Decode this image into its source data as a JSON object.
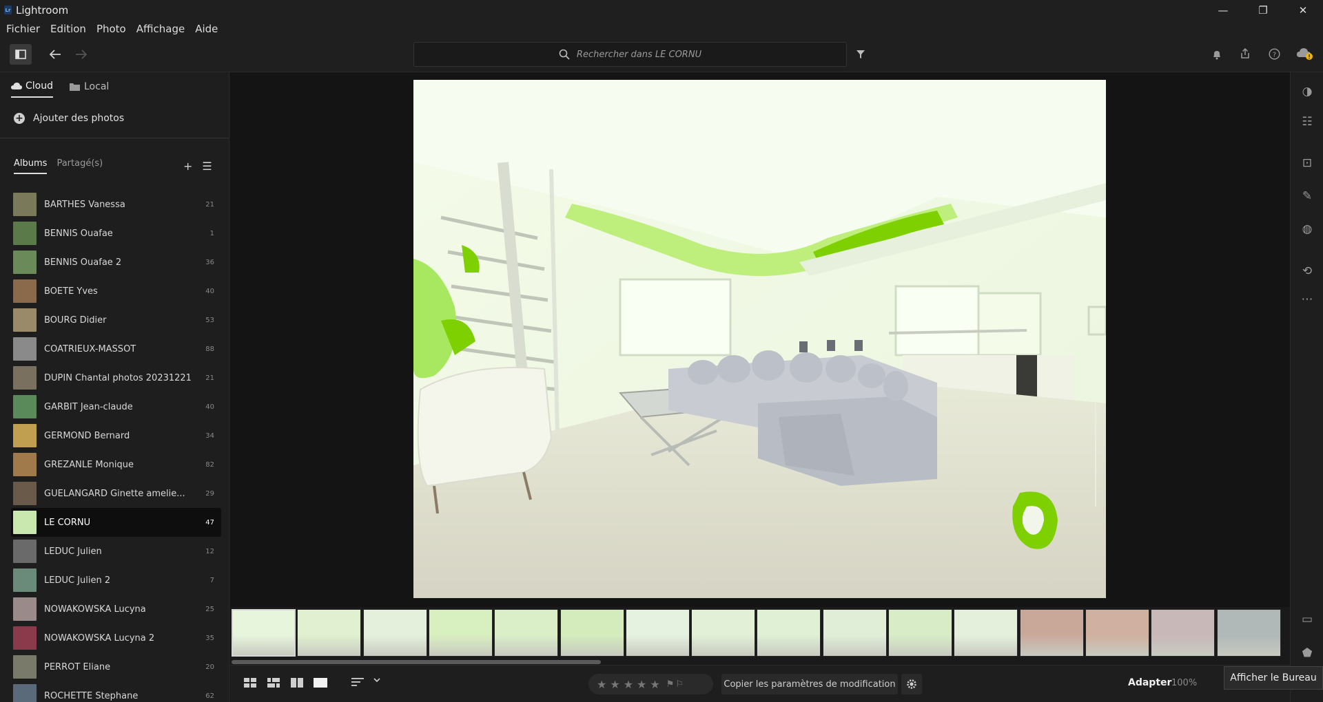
{
  "window": {
    "title": "Lightroom",
    "controls": [
      "minimize-icon",
      "restore-icon",
      "close-icon"
    ]
  },
  "menu": [
    "Fichier",
    "Edition",
    "Photo",
    "Affichage",
    "Aide"
  ],
  "search": {
    "placeholder": "Rechercher dans LE CORNU"
  },
  "source_tabs": {
    "cloud": "Cloud",
    "local": "Local"
  },
  "add_photos": "Ajouter des photos",
  "album_tabs": {
    "albums": "Albums",
    "shared": "Partagé(s)"
  },
  "albums": [
    {
      "name": "BARTHES Vanessa",
      "count": "21",
      "color": "#7a7a5a"
    },
    {
      "name": "BENNIS Ouafae",
      "count": "1",
      "color": "#5a7a4a"
    },
    {
      "name": "BENNIS Ouafae 2",
      "count": "36",
      "color": "#6a8a5a"
    },
    {
      "name": "BOETE Yves",
      "count": "40",
      "color": "#8a6a4a"
    },
    {
      "name": "BOURG Didier",
      "count": "53",
      "color": "#9a8a6a"
    },
    {
      "name": "COATRIEUX-MASSOT",
      "count": "88",
      "color": "#8a8a8a"
    },
    {
      "name": "DUPIN Chantal photos 20231221",
      "count": "21",
      "color": "#7a7060"
    },
    {
      "name": "GARBIT Jean-claude",
      "count": "40",
      "color": "#5a8a5a"
    },
    {
      "name": "GERMOND Bernard",
      "count": "34",
      "color": "#c0a050"
    },
    {
      "name": "GREZANLE Monique",
      "count": "82",
      "color": "#a07a4a"
    },
    {
      "name": "GUELANGARD Ginette amelie...",
      "count": "29",
      "color": "#6a5a4a"
    },
    {
      "name": "LE CORNU",
      "count": "47",
      "color": "#c8e8b0"
    },
    {
      "name": "LEDUC Julien",
      "count": "12",
      "color": "#6a6a6a"
    },
    {
      "name": "LEDUC Julien 2",
      "count": "7",
      "color": "#6a8a7a"
    },
    {
      "name": "NOWAKOWSKA Lucyna",
      "count": "25",
      "color": "#9a8a8a"
    },
    {
      "name": "NOWAKOWSKA Lucyna 2",
      "count": "35",
      "color": "#8a3a4a"
    },
    {
      "name": "PERROT Eliane",
      "count": "20",
      "color": "#7a7a6a"
    },
    {
      "name": "ROCHETTE Stephane",
      "count": "62",
      "color": "#5a6a7a"
    }
  ],
  "selected_album": "LE CORNU",
  "filmstrip": [
    {
      "tone": "#e8f5dd"
    },
    {
      "tone": "#e0f0d0"
    },
    {
      "tone": "#e4f0dc"
    },
    {
      "tone": "#d8efc0"
    },
    {
      "tone": "#daeec8"
    },
    {
      "tone": "#d4ecbc"
    },
    {
      "tone": "#e6f2e0"
    },
    {
      "tone": "#e2f0d8"
    },
    {
      "tone": "#dff0d4"
    },
    {
      "tone": "#e0eed8"
    },
    {
      "tone": "#d8ecc8"
    },
    {
      "tone": "#e4f0dc"
    },
    {
      "tone": "#c9a89a"
    },
    {
      "tone": "#d0b0a0"
    },
    {
      "tone": "#c8b8b8"
    },
    {
      "tone": "#b0b8b8"
    }
  ],
  "bottom": {
    "copy_settings": "Copier les paramètres de modification",
    "fit": "Adapter",
    "zoom": "100%"
  },
  "tooltip": "Afficher le Bureau",
  "accent": "#7fd000"
}
